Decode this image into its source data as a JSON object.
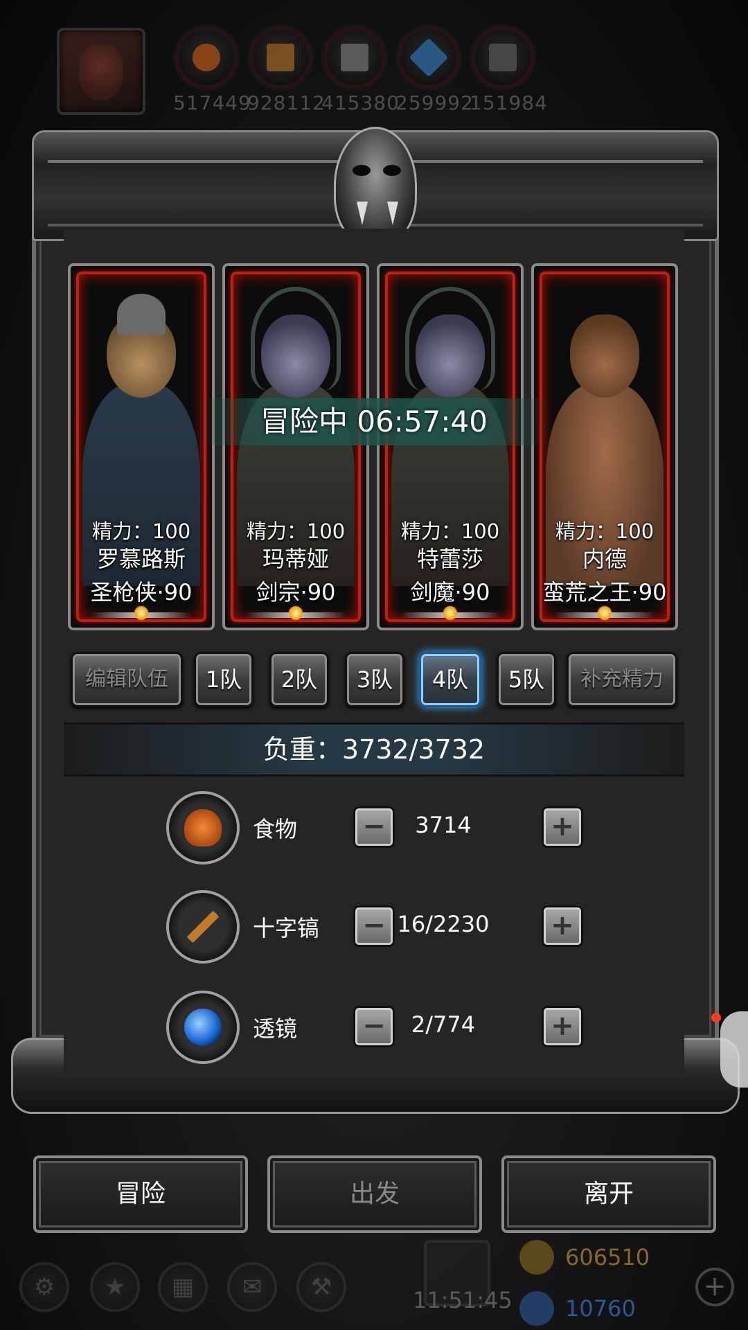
{
  "resources": [
    {
      "icon": "food-icon",
      "value": "517449",
      "color": "#d86a1a"
    },
    {
      "icon": "wood-icon",
      "value": "928112",
      "color": "#c07a2a"
    },
    {
      "icon": "iron-icon",
      "value": "415380",
      "color": "#8a8a8a"
    },
    {
      "icon": "crystal-icon",
      "value": "259992",
      "color": "#3a8ad0"
    },
    {
      "icon": "ore-icon",
      "value": "151984",
      "color": "#6a6a6a"
    }
  ],
  "heroes": [
    {
      "stamina": "精力：100",
      "name": "罗慕路斯",
      "class": "圣枪侠·90",
      "skin": "#b89060",
      "outfit": "#2a3a4a"
    },
    {
      "stamina": "精力：100",
      "name": "玛蒂娅",
      "class": "剑宗·90",
      "skin": "#8a8aa8",
      "outfit": "#3a4038"
    },
    {
      "stamina": "精力：100",
      "name": "特蕾莎",
      "class": "剑魔·90",
      "skin": "#8a8aa8",
      "outfit": "#3a4038"
    },
    {
      "stamina": "精力：100",
      "name": "内德",
      "class": "蛮荒之王·90",
      "skin": "#a06a48",
      "outfit": "#5a3a28"
    }
  ],
  "adventure_timer": "冒险中 06:57:40",
  "team_bar": {
    "edit_label": "编辑队伍",
    "teams": [
      "1队",
      "2队",
      "3队",
      "4队",
      "5队"
    ],
    "selected_team": "4队",
    "refill_label": "补充精力"
  },
  "load": "负重：3732/3732",
  "supplies": [
    {
      "icon": "meat-icon",
      "label": "食物",
      "value": "3714",
      "color": "#d86a1a"
    },
    {
      "icon": "pickaxe-icon",
      "label": "十字镐",
      "value": "16/2230",
      "color": "#c07a2a"
    },
    {
      "icon": "lens-icon",
      "label": "透镜",
      "value": "2/774",
      "color": "#2a7ad8"
    }
  ],
  "supply_controls": {
    "minus": "−",
    "plus": "+"
  },
  "actions": {
    "adventure": "冒险",
    "depart": "出发",
    "leave": "离开"
  },
  "bottom": {
    "clock": "11:51:45",
    "gold": "606510",
    "gems": "10760",
    "gold_color": "#8a6a20",
    "gem_color": "#2a5a9a"
  },
  "bottom_icons": [
    "settings-icon",
    "achievement-icon",
    "shop-icon",
    "mail-icon",
    "guild-icon"
  ]
}
